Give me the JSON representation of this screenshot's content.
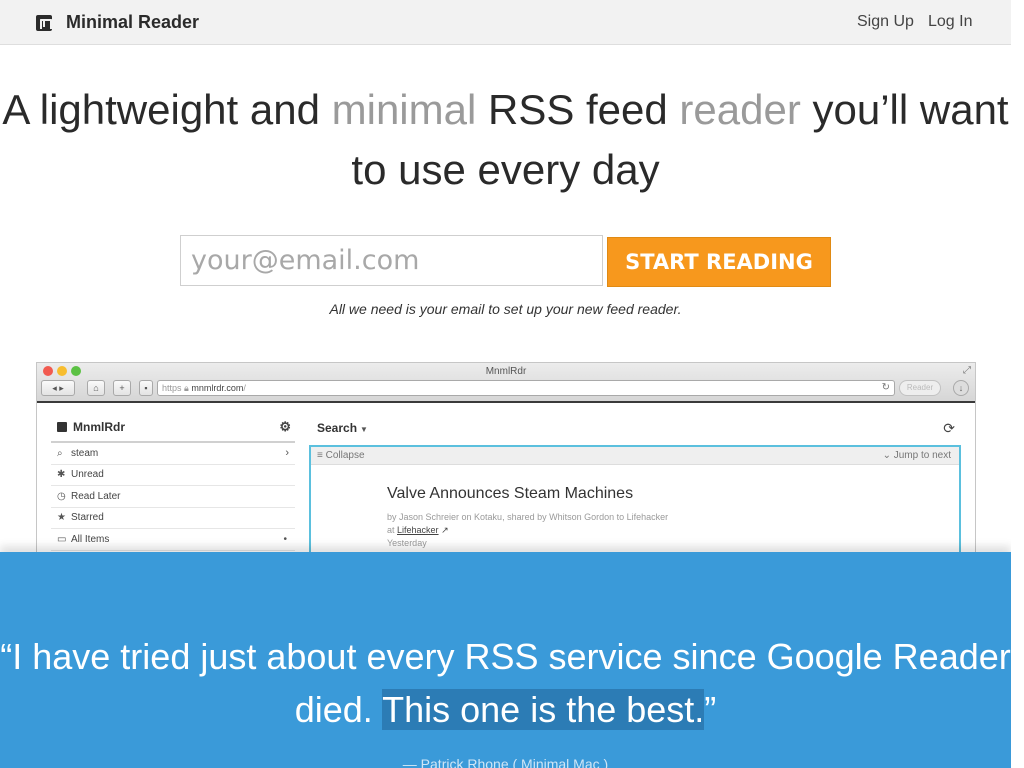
{
  "nav": {
    "brand": "Minimal Reader",
    "signup": "Sign Up",
    "login": "Log In"
  },
  "hero": {
    "title_part1": "A lightweight and ",
    "title_muted1": "minimal",
    "title_part2": " RSS feed ",
    "title_muted2": "reader",
    "title_part3": " you’ll want to use every day",
    "email_placeholder": "your@email.com",
    "cta": "START READING",
    "hint": "All we need is your email to set up your new feed reader."
  },
  "mock_browser": {
    "window_title": "MnmlRdr",
    "url_protocol": "https",
    "url_host": "mnmlrdr.com",
    "url_path": "/",
    "reader_button": "Reader",
    "sidebar": {
      "brand": "MnmlRdr",
      "items": [
        {
          "icon": "search-icon",
          "label": "steam"
        },
        {
          "icon": "asterisk-icon",
          "label": "Unread"
        },
        {
          "icon": "clock-icon",
          "label": "Read Later"
        },
        {
          "icon": "star-icon",
          "label": "Starred"
        },
        {
          "icon": "folder-icon",
          "label": "All Items"
        }
      ]
    },
    "main": {
      "search_label": "Search",
      "collapse_label": "Collapse",
      "jump_label": "Jump to next",
      "article_title": "Valve Announces Steam Machines",
      "byline": "by Jason Schreier on Kotaku, shared by Whitson Gordon to Lifehacker",
      "at_prefix": "at ",
      "source": "Lifehacker",
      "date": "Yesterday"
    }
  },
  "testimonial": {
    "quote_start": "“I have tried just about every RSS service since Google Reader died. ",
    "quote_highlight": "This one is the best.",
    "quote_end": "”",
    "attribution": "— Patrick Rhone ( Minimal Mac )"
  },
  "colors": {
    "accent_orange": "#f7981d",
    "testimonial_blue": "#3a9ad9",
    "article_border": "#5bc0de"
  }
}
